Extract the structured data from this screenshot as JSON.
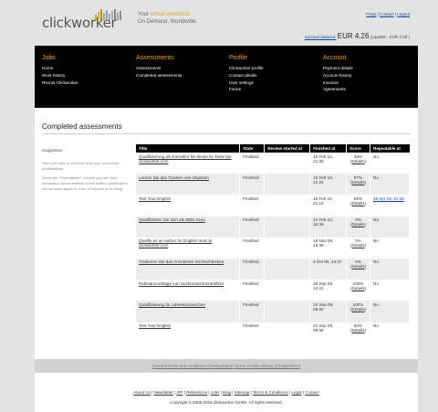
{
  "header": {
    "logo_text": "clickworker",
    "tagline_prefix": "Your ",
    "tagline_accent": "virtual workforce",
    "tagline_line2": "On Demand. Worldwide.",
    "toplinks": [
      "FAQs",
      "Contact",
      "Logout"
    ],
    "balance_label": "Account balance:",
    "balance_amount": "EUR 4.26",
    "balance_payable": "(payable : EUR 4.26 )"
  },
  "colors": {
    "accent": "#f0a500",
    "nav_bg": "#000000",
    "link": "#0645ad"
  },
  "nav": [
    {
      "title": "Jobs",
      "items": [
        "Home",
        "Work history",
        "Recruit Clickworker"
      ]
    },
    {
      "title": "Assessments",
      "items": [
        "Assessments",
        "Completed assessments"
      ]
    },
    {
      "title": "Profile",
      "items": [
        "Clickworker profile",
        "Contact details",
        "User settings",
        "Forum"
      ]
    },
    {
      "title": "Account",
      "items": [
        "Payment details",
        "Account history",
        "Invoices",
        "Agreements"
      ]
    }
  ],
  "main": {
    "title": "Completed assessments",
    "sidebar": {
      "title": "Suggestion",
      "paragraphs": [
        "Here you have a overview of all your completed qualifications.",
        "Under the \"Repeatable?\" column you can read information about whether or not a failed qualification can be taken again in order to improve your rating."
      ]
    },
    "table": {
      "headers": [
        "Title",
        "State",
        "Review started at",
        "Finished at",
        "Score",
        "Repeatable at"
      ],
      "rows": [
        {
          "title": "Qualifizierung als Korrektor für deutsche Texte bei clickworker.com",
          "state": "Finished",
          "review": "",
          "finished": "15 Feb 10, 21:30",
          "score": "35%",
          "details": "Details",
          "repeat": "No",
          "repeat_link": false
        },
        {
          "title": "Lernen Sie das Tracken von Objekten",
          "state": "Finished",
          "review": "",
          "finished": "15 Feb 10, 21:24",
          "score": "57%",
          "details": "Details",
          "repeat": "No",
          "repeat_link": false
        },
        {
          "title": "Test Your English",
          "state": "Finished",
          "review": "",
          "finished": "15 Feb 10, 21:18",
          "score": "85%",
          "details": "Details",
          "repeat": "16 Apr 10, 21:18",
          "repeat_link": true
        },
        {
          "title": "Qualifizieren Sie sich als SMS Guru",
          "state": "Finished",
          "review": "",
          "finished": "10 Feb 10, 16:39",
          "score": "0%",
          "details": "Details",
          "repeat": "No",
          "repeat_link": false
        },
        {
          "title": "Qualify as an author for English texts at clickworker.com",
          "state": "Finished",
          "review": "",
          "finished": "18 Nov 09, 16:48",
          "score": "0%",
          "details": "Details",
          "repeat": "No",
          "repeat_link": false
        },
        {
          "title": "Trainieren Sie das Annotieren mit Rechtecken",
          "state": "Finished",
          "review": "",
          "finished": "4 Oct 09, 14:37",
          "score": "0%",
          "details": "Details",
          "repeat": "No",
          "repeat_link": false
        },
        {
          "title": "Relevanzumfrage von Suchmaschinentreffern",
          "state": "Finished",
          "review": "",
          "finished": "28 Sep 09, 14:22",
          "score": "100%",
          "details": "Details",
          "repeat": "No",
          "repeat_link": false
        },
        {
          "title": "Qualifizierung für Adressrecherchen",
          "state": "Finished",
          "review": "",
          "finished": "24 Sep 09, 09:50",
          "score": "100%",
          "details": "Details",
          "repeat": "No",
          "repeat_link": false
        },
        {
          "title": "Test Your English",
          "state": "Finished",
          "review": "",
          "finished": "22 Sep 09, 09:56",
          "score": "50%",
          "details": "Details",
          "repeat": "No",
          "repeat_link": false
        }
      ]
    }
  },
  "footer": {
    "terms_link": "General terms and conditions (Clickworkers)",
    "privacy_link": "Terms of data privacy (Clickworkers)",
    "bottom_links": [
      "About Us",
      "Newsletter",
      "API",
      "References",
      "Jobs",
      "Blog",
      "Sitemap",
      "Terms & Conditions",
      "Legal",
      "Contact"
    ],
    "copyright": "Copyright © 2005-2016 clickworker GmbH. All rights reserved."
  }
}
